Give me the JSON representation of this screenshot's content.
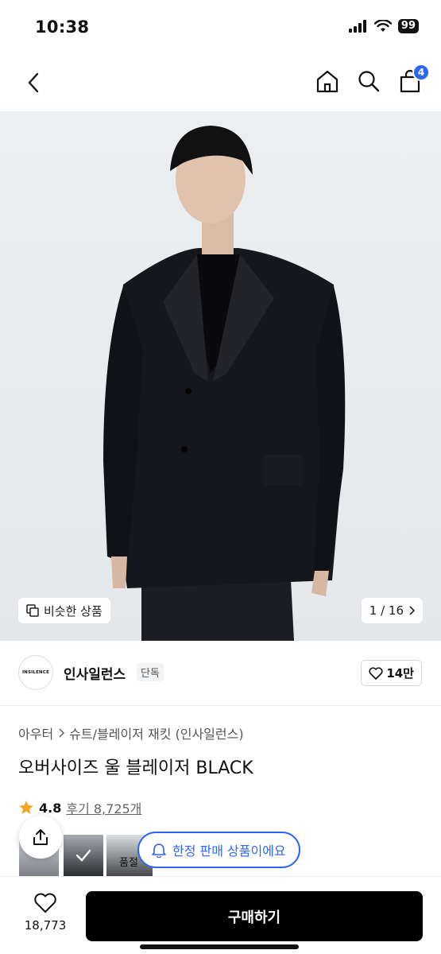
{
  "status_bar": {
    "time": "10:38",
    "battery": "99",
    "icons": [
      "signal-icon",
      "wifi-icon",
      "battery-icon"
    ]
  },
  "nav": {
    "icons": [
      "back-icon",
      "home-icon",
      "search-icon",
      "bag-icon"
    ],
    "cart_count": "4"
  },
  "product_image": {
    "similar_label": "비슷한 상품",
    "pager": "1 / 16"
  },
  "brand": {
    "logo_text": "INSILENCE",
    "name": "인사일런스",
    "tag": "단독",
    "likes": "14만"
  },
  "breadcrumb": {
    "category": "아우터",
    "subcategory": "슈트/블레이저 재킷 (인사일런스)"
  },
  "product": {
    "title": "오버사이즈 울 블레이저 BLACK"
  },
  "rating": {
    "score": "4.8",
    "reviews": "후기 8,725개"
  },
  "thumbnails": {
    "soldout_label": "품절"
  },
  "toast": {
    "text": "한정 판매 상품이에요"
  },
  "bottom_bar": {
    "wish_count": "18,773",
    "buy_label": "구매하기"
  },
  "colors": {
    "accent": "#2b66f5",
    "buy_button": "#000000"
  }
}
